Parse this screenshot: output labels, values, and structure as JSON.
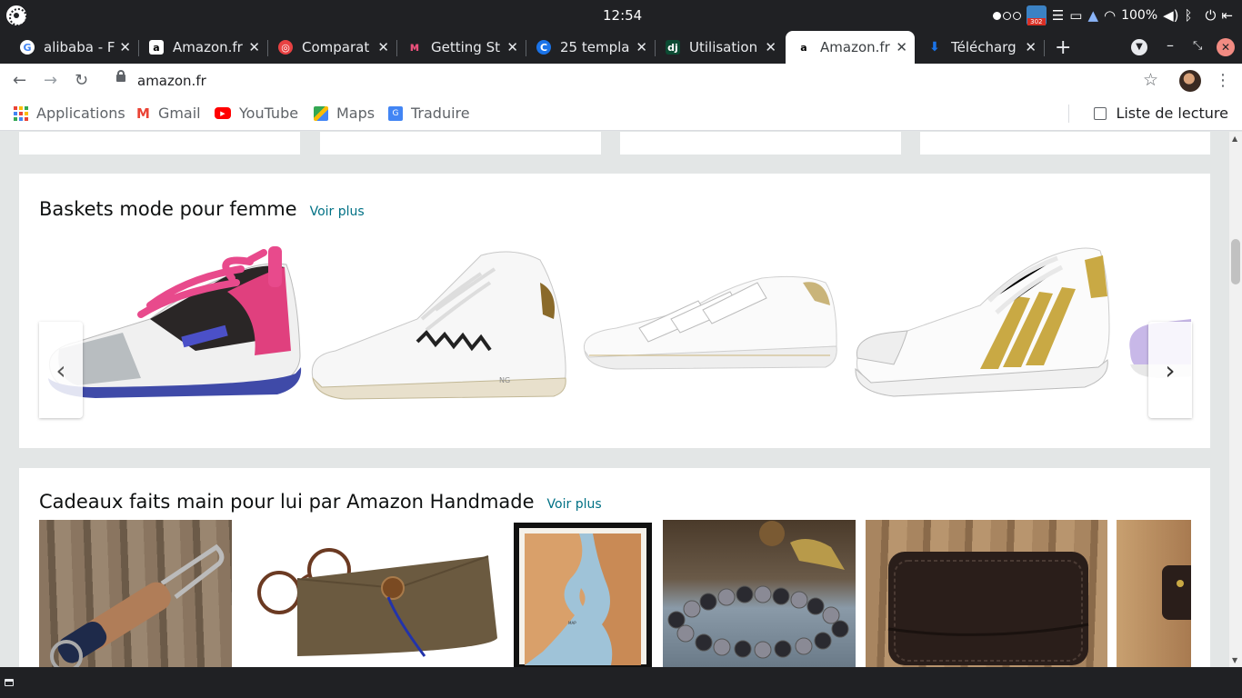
{
  "system": {
    "clock": "12:54",
    "notification_badge": "302",
    "battery": "100%"
  },
  "tabs": [
    {
      "title": "alibaba - F",
      "favicon": "google-icon",
      "color": "#4285f4"
    },
    {
      "title": "Amazon.fr",
      "favicon": "amazon-icon",
      "color": "#ffffff"
    },
    {
      "title": "Comparat",
      "favicon": "comparateur-icon",
      "color": "#e84142"
    },
    {
      "title": "Getting St",
      "favicon": "getting-started-icon",
      "color": "#e8507a"
    },
    {
      "title": "25 templa",
      "favicon": "canva-icon",
      "color": "#1a73e8"
    },
    {
      "title": "Utilisation",
      "favicon": "django-icon",
      "color": "#0c4b33"
    },
    {
      "title": "Amazon.fr",
      "favicon": "amazon-icon",
      "color": "#ffffff",
      "active": true
    },
    {
      "title": "Télécharg",
      "favicon": "download-icon",
      "color": "#1a73e8"
    }
  ],
  "toolbar": {
    "url": "amazon.fr"
  },
  "bookmarks": {
    "items": [
      "Applications",
      "Gmail",
      "YouTube",
      "Maps",
      "Traduire"
    ],
    "reading_list": "Liste de lecture"
  },
  "sections": {
    "baskets": {
      "title": "Baskets mode pour femme",
      "more": "Voir plus",
      "products": [
        "puma-pink-sneaker",
        "nero-giardini-high-top",
        "velcro-white-sneaker",
        "adidas-superstar-gold",
        "purple-sneaker-partial"
      ]
    },
    "handmade": {
      "title": "Cadeaux faits main pour lui par Amazon Handmade",
      "more": "Voir plus",
      "products": [
        "leather-keychain",
        "glasses-leather-pouch",
        "framed-map",
        "bead-bracelet",
        "leather-card-wallet",
        "leather-item-partial"
      ]
    }
  }
}
